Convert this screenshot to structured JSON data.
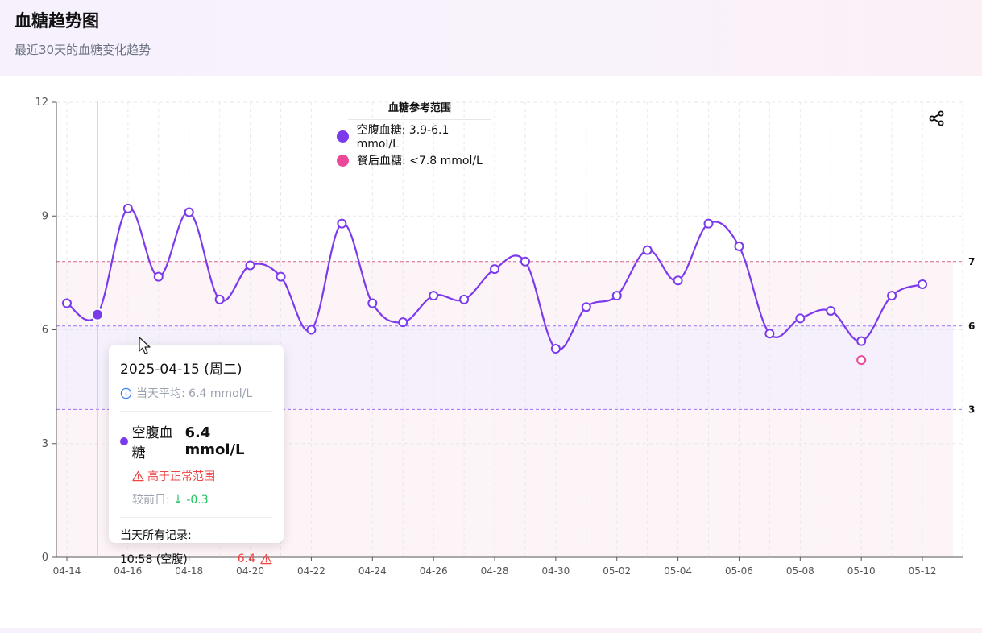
{
  "header": {
    "title": "血糖趋势图",
    "subtitle": "最近30天的血糖变化趋势"
  },
  "legend": {
    "title": "血糖参考范围",
    "items": [
      {
        "label": "空腹血糖: 3.9-6.1 mmol/L",
        "color": "#7c3aed"
      },
      {
        "label": "餐后血糖: <7.8 mmol/L",
        "color": "#ec4899"
      }
    ]
  },
  "toolbar": {
    "share_icon": "share-icon"
  },
  "tooltip": {
    "date": "2025-04-15 (周二)",
    "avg_label": "当天平均: 6.4 mmol/L",
    "main_label": "空腹血糖",
    "main_value": "6.4 mmol/L",
    "warning": "高于正常范围",
    "prev_label": "较前日: ",
    "prev_delta": "↓ -0.3",
    "records_title": "当天所有记录:",
    "records": [
      {
        "time": "10:58 (空腹)",
        "value": "6.4"
      }
    ]
  },
  "chart_data": {
    "type": "line",
    "x": [
      "04-14",
      "04-15",
      "04-16",
      "04-17",
      "04-18",
      "04-19",
      "04-20",
      "04-21",
      "04-22",
      "04-23",
      "04-24",
      "04-25",
      "04-26",
      "04-27",
      "04-28",
      "04-29",
      "04-30",
      "05-01",
      "05-02",
      "05-03",
      "05-04",
      "05-05",
      "05-06",
      "05-07",
      "05-08",
      "05-09",
      "05-10",
      "05-11",
      "05-12"
    ],
    "x_tick_labels": [
      "04-14",
      "04-16",
      "04-18",
      "04-20",
      "04-22",
      "04-24",
      "04-26",
      "04-28",
      "04-30",
      "05-02",
      "05-04",
      "05-06",
      "05-08",
      "05-10",
      "05-12"
    ],
    "series": [
      {
        "color": "#7c3aed",
        "values": [
          6.7,
          6.4,
          9.2,
          7.4,
          9.1,
          6.8,
          7.7,
          7.4,
          6.0,
          8.8,
          6.7,
          6.2,
          6.9,
          6.8,
          7.6,
          7.8,
          5.5,
          6.6,
          6.9,
          8.1,
          7.3,
          8.8,
          8.2,
          5.9,
          6.3,
          6.5,
          5.7,
          6.9,
          7.2
        ]
      },
      {
        "color": "#ec4899",
        "points": [
          {
            "x": "05-10",
            "y": 5.2
          }
        ]
      }
    ],
    "ylim": [
      0,
      12
    ],
    "yticks": [
      0,
      3,
      6,
      9,
      12
    ],
    "reference_lines": [
      {
        "value": 7.8,
        "label": "7",
        "color": "#d1477a"
      },
      {
        "value": 6.1,
        "label": "6",
        "color": "#8b5cf6"
      },
      {
        "value": 3.9,
        "label": "3",
        "color": "#8b5cf6"
      }
    ],
    "highlight_index": 1,
    "grid": true
  }
}
